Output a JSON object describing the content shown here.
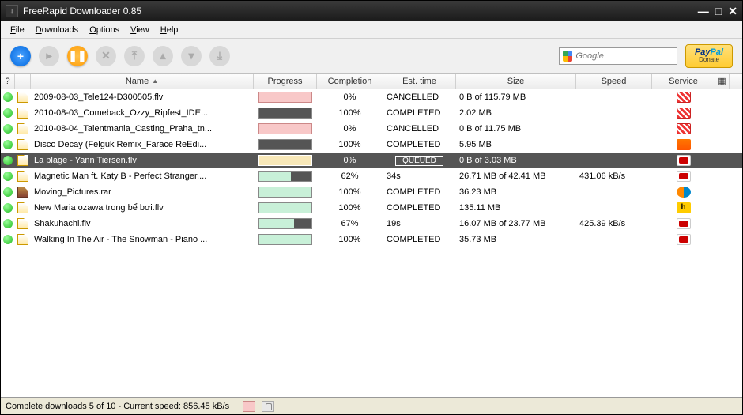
{
  "window": {
    "title": "FreeRapid Downloader 0.85"
  },
  "menu": {
    "file": "File",
    "downloads": "Downloads",
    "options": "Options",
    "view": "View",
    "help": "Help"
  },
  "search": {
    "placeholder": "Google"
  },
  "paypal": {
    "brand_a": "Pay",
    "brand_b": "Pal",
    "sub": "Donate"
  },
  "columns": {
    "q": "?",
    "name": "Name",
    "progress": "Progress",
    "completion": "Completion",
    "est": "Est. time",
    "size": "Size",
    "speed": "Speed",
    "service": "Service"
  },
  "rows": [
    {
      "name": "2009-08-03_Tele124-D300505.flv",
      "progress_type": "pink",
      "progress_pct": 0,
      "completion": "0%",
      "est": "CANCELLED",
      "size": "0 B of 115.79 MB",
      "speed": "",
      "svc": "red",
      "ico": "doc"
    },
    {
      "name": "2010-08-03_Comeback_Ozzy_Ripfest_IDE...",
      "progress_type": "dark",
      "progress_pct": 100,
      "completion": "100%",
      "est": "COMPLETED",
      "size": "2.02 MB",
      "speed": "",
      "svc": "red",
      "ico": "doc"
    },
    {
      "name": "2010-08-04_Talentmania_Casting_Praha_tn...",
      "progress_type": "pink",
      "progress_pct": 0,
      "completion": "0%",
      "est": "CANCELLED",
      "size": "0 B of 11.75 MB",
      "speed": "",
      "svc": "red",
      "ico": "doc"
    },
    {
      "name": "Disco Decay (Felguk Remix_Farace ReEdi...",
      "progress_type": "dark",
      "progress_pct": 100,
      "completion": "100%",
      "est": "COMPLETED",
      "size": "5.95 MB",
      "speed": "",
      "svc": "sc",
      "ico": "doc"
    },
    {
      "name": "La plage - Yann Tiersen.flv",
      "progress_type": "cream",
      "progress_pct": 0,
      "completion": "0%",
      "est": "QUEUED",
      "size": "0 B of 3.03 MB",
      "speed": "",
      "svc": "yt",
      "ico": "doc",
      "selected": true
    },
    {
      "name": "Magnetic Man ft. Katy B - Perfect Stranger,...",
      "progress_type": "fill",
      "progress_pct": 62,
      "completion": "62%",
      "est": "34s",
      "size": "26.71 MB of 42.41 MB",
      "speed": "431.06 kB/s",
      "svc": "yt",
      "ico": "doc"
    },
    {
      "name": "Moving_Pictures.rar",
      "progress_type": "fill",
      "progress_pct": 100,
      "completion": "100%",
      "est": "COMPLETED",
      "size": "36.23 MB",
      "speed": "",
      "svc": "swirl",
      "ico": "rar"
    },
    {
      "name": "New Maria ozawa trong bể bơi.flv",
      "progress_type": "fill",
      "progress_pct": 100,
      "completion": "100%",
      "est": "COMPLETED",
      "size": "135.11 MB",
      "speed": "",
      "svc": "h",
      "ico": "doc"
    },
    {
      "name": "Shakuhachi.flv",
      "progress_type": "fill",
      "progress_pct": 67,
      "completion": "67%",
      "est": "19s",
      "size": "16.07 MB of 23.77 MB",
      "speed": "425.39 kB/s",
      "svc": "yt",
      "ico": "doc"
    },
    {
      "name": "Walking In The Air - The Snowman - Piano ...",
      "progress_type": "fill",
      "progress_pct": 100,
      "completion": "100%",
      "est": "COMPLETED",
      "size": "35.73 MB",
      "speed": "",
      "svc": "yt",
      "ico": "doc"
    }
  ],
  "status": {
    "text": "Complete downloads 5 of 10 - Current speed: 856.45 kB/s"
  }
}
